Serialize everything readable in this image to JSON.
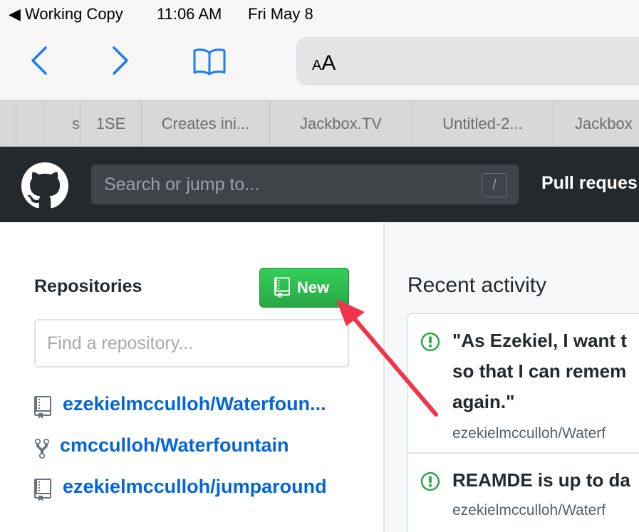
{
  "status_bar": {
    "back_app": "◀ Working Copy",
    "time": "11:06 AM",
    "date": "Fri May 8"
  },
  "toolbar": {
    "address_aa": "AA"
  },
  "tabs": [
    {
      "label": "s"
    },
    {
      "label": "1SE"
    },
    {
      "label": "Creates ini..."
    },
    {
      "label": "Jackbox.TV"
    },
    {
      "label": "Untitled-2..."
    },
    {
      "label": "Jackbox"
    }
  ],
  "github": {
    "search_placeholder": "Search or jump to...",
    "search_shortcut": "/",
    "pull_requests": "Pull reques"
  },
  "repos": {
    "heading": "Repositories",
    "new_label": "New",
    "find_placeholder": "Find a repository...",
    "items": [
      {
        "name": "ezekielmcculloh/Waterfoun...",
        "icon": "repo-icon"
      },
      {
        "name": "cmcculloh/Waterfountain",
        "icon": "fork-icon"
      },
      {
        "name": "ezekielmcculloh/jumparound",
        "icon": "repo-icon"
      }
    ]
  },
  "recent": {
    "heading": "Recent activity",
    "items": [
      {
        "line1": "\"As Ezekiel, I want t",
        "line2": "so that I can remem",
        "line3": "again.\"",
        "repo": "ezekielmcculloh/Waterf"
      },
      {
        "line1": "REAMDE is up to da",
        "repo": "ezekielmcculloh/Waterf"
      }
    ]
  },
  "colors": {
    "header_bg": "#24292e",
    "new_button": "#28a745",
    "link": "#0366d6",
    "annotation_arrow": "#f0354b",
    "issue_open": "#28a745"
  }
}
